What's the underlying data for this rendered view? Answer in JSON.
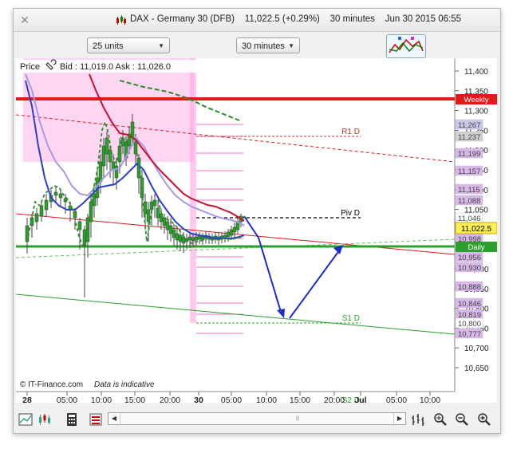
{
  "window": {
    "close_glyph": "✕",
    "instrument": "DAX - Germany 30 (DFB)",
    "price_change": "11,022.5 (+0.29%)",
    "timeframe": "30 minutes",
    "datetime": "Jun 30 2015 06:55"
  },
  "toolbar": {
    "units_value": "25 units",
    "timeframe_value": "30 minutes"
  },
  "chart": {
    "price_label": "Price",
    "quote": "Bid : 11,019.0 Ask : 11,026.0",
    "watermark": "© IT-Finance.com",
    "disclaimer": "Data is indicative",
    "current_price": "11,022.5",
    "weekly_label": "Weekly",
    "daily_label": "Daily",
    "levels": {
      "r1": "R1 D",
      "piv": "Piv D",
      "s1": "S1 D",
      "s2": "S2 D"
    },
    "colors": {
      "weekly": "#e0191b",
      "daily": "#2ca02c",
      "pink_zone": "#ff9ee0",
      "projection": "#1a2ccc",
      "ma_red": "#c8102e",
      "ma_blue": "#2a3fd0",
      "ma_lavender": "#a898e8",
      "ma_green": "#2e8b2e"
    }
  },
  "y_axis_ticks": [
    "11,400",
    "11,350",
    "11,300",
    "11,250",
    "11,200",
    "11,150",
    "11,100",
    "11,050",
    "11,000",
    "10,950",
    "10,900",
    "10,850",
    "10,800",
    "10,750",
    "10,700",
    "10,650"
  ],
  "price_boxes": [
    {
      "text": "11,267",
      "color": "#c8c8e8"
    },
    {
      "text": "11,237",
      "color": "#d0d0d0"
    },
    {
      "text": "11,199",
      "color": "#d8b8e8"
    },
    {
      "text": "11,157",
      "color": "#d8b8e8"
    },
    {
      "text": "11,115",
      "color": "#d8b8e8"
    },
    {
      "text": "11,088",
      "color": "#d8b8e8"
    },
    {
      "text": "11,046",
      "color": "#ffffff"
    },
    {
      "text": "10,998",
      "color": "#d8b8e8"
    },
    {
      "text": "10,956",
      "color": "#d8b8e8"
    },
    {
      "text": "10,930",
      "color": "#d8b8e8"
    },
    {
      "text": "10,888",
      "color": "#d8b8e8"
    },
    {
      "text": "10,846",
      "color": "#d8b8e8"
    },
    {
      "text": "10,819",
      "color": "#d8b8e8"
    },
    {
      "text": "10,800",
      "color": "#ffffff"
    },
    {
      "text": "10,777",
      "color": "#d8b8e8"
    }
  ],
  "x_axis_ticks": [
    {
      "text": "28",
      "bold": true
    },
    {
      "text": "05:00",
      "bold": false
    },
    {
      "text": "10:00",
      "bold": false
    },
    {
      "text": "15:00",
      "bold": false
    },
    {
      "text": "20:00",
      "bold": false
    },
    {
      "text": "30",
      "bold": true
    },
    {
      "text": "05:00",
      "bold": false
    },
    {
      "text": "10:00",
      "bold": false
    },
    {
      "text": "15:00",
      "bold": false
    },
    {
      "text": "20:00",
      "bold": false
    },
    {
      "text": "Jul",
      "bold": true
    },
    {
      "text": "05:00",
      "bold": false
    },
    {
      "text": "10:00",
      "bold": false
    }
  ],
  "footer": {
    "buttons": [
      "chart-type-icon",
      "candlestick-icon",
      "calculator-icon",
      "indicators-icon"
    ],
    "right_buttons": [
      "bar-chart-icon",
      "zoom-fit-icon",
      "zoom-out-icon",
      "zoom-in-icon"
    ]
  }
}
